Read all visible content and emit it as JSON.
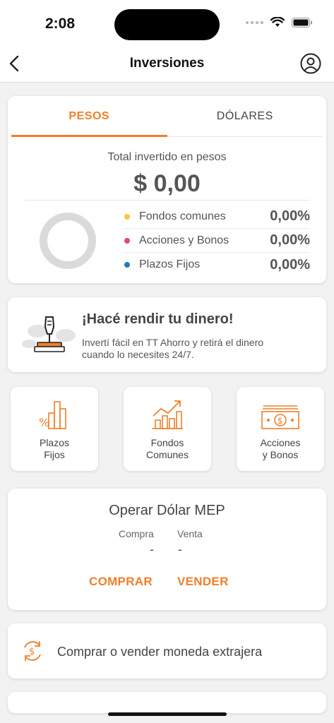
{
  "status_bar": {
    "time": "2:08"
  },
  "nav": {
    "title": "Inversiones",
    "back_icon": "chevron-left-icon",
    "profile_icon": "user-circle-icon"
  },
  "summary": {
    "tabs": [
      {
        "label": "PESOS",
        "active": true
      },
      {
        "label": "DÓLARES",
        "active": false
      }
    ],
    "total_label": "Total invertido en pesos",
    "total_amount": "$ 0,00",
    "legend": [
      {
        "name": "Fondos comunes",
        "value": "0,00%",
        "color": "#f5c842"
      },
      {
        "name": "Acciones y Bonos",
        "value": "0,00%",
        "color": "#e0457b"
      },
      {
        "name": "Plazos Fijos",
        "value": "0,00%",
        "color": "#1e7ac8"
      }
    ]
  },
  "promo": {
    "title": "¡Hacé rendir tu dinero!",
    "text": "Invertí fácil en TT Ahorro y retirá el dinero cuando lo necesites 24/7."
  },
  "tiles": [
    {
      "line1": "Plazos",
      "line2": "Fijos",
      "icon": "percent-bars-icon"
    },
    {
      "line1": "Fondos",
      "line2": "Comunes",
      "icon": "growth-chart-icon"
    },
    {
      "line1": "Acciones",
      "line2": "y Bonos",
      "icon": "banknote-icon"
    }
  ],
  "mep": {
    "title": "Operar Dólar MEP",
    "buy_label": "Compra",
    "sell_label": "Venta",
    "buy_value": "-",
    "sell_value": "-",
    "buy_button": "COMPRAR",
    "sell_button": "VENDER"
  },
  "fx": {
    "label": "Comprar o vender moneda extrajera",
    "icon": "currency-exchange-icon"
  },
  "colors": {
    "accent": "#f07f2a",
    "text": "#444444",
    "background": "#f2f2f2"
  }
}
